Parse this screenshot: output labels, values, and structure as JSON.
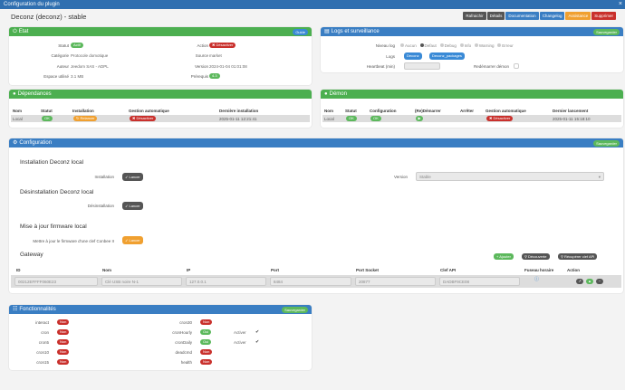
{
  "dialog": {
    "title": "Configuration du plugin",
    "close": "×"
  },
  "plugin": {
    "title": "Deconz (deconz) - stable"
  },
  "toolbar": [
    {
      "label": "Rafraichir",
      "color": "#555555"
    },
    {
      "label": "Détails",
      "color": "#555555"
    },
    {
      "label": "Documentation",
      "color": "#3a7ec3"
    },
    {
      "label": "Changelog",
      "color": "#3a7ec3"
    },
    {
      "label": "Assistance",
      "color": "#f0a030"
    },
    {
      "label": "Supprimer",
      "color": "#c9302c"
    }
  ],
  "etat": {
    "title": "Etat",
    "guide": "Guide",
    "statut_label": "Statut",
    "statut": "Actif",
    "categorie_label": "Catégorie",
    "categorie": "Protocole domotique",
    "auteur_label": "Auteur",
    "auteur": "Jeedom SAS - ADPL",
    "espace_label": "Espace utilisé",
    "espace": "3.1 MB",
    "action_label": "Action",
    "action": "Désactiver",
    "source_label": "Source",
    "source": "market",
    "version_label": "Version",
    "version": "2024-01-04 01:01:08",
    "prerequis_label": "Prérequis",
    "prerequis": "4.3"
  },
  "logs": {
    "title": "Logs et surveillance",
    "save": "Sauvegarder",
    "niveau_label": "Niveau log",
    "levels": [
      "Aucun",
      "Defaut",
      "Debug",
      "Info",
      "Warning",
      "Erreur"
    ],
    "logs_label": "Logs",
    "log_buttons": [
      "Deconz",
      "Deconz_packages"
    ],
    "heartbeat_label": "Heartbeat (min)",
    "redemarrer_label": "Redémarrer démon"
  },
  "deps": {
    "title": "Dépendances",
    "headers": [
      "Nom",
      "Statut",
      "Installation",
      "Gestion automatique",
      "Dernière installation"
    ],
    "row": {
      "nom": "Local",
      "statut": "OK",
      "installation": "Relancer",
      "gestion": "Désactiver",
      "derniere": "2025-01-11 12:21:41"
    }
  },
  "demon": {
    "title": "Démon",
    "headers": [
      "Nom",
      "Statut",
      "Configuration",
      "(Re)Démarrer",
      "Arrêter",
      "Gestion automatique",
      "Dernier lancement"
    ],
    "row": {
      "nom": "Local",
      "statut": "OK",
      "configuration": "OK",
      "gestion": "Désactiver",
      "dernier": "2025-01-11 15:18:10"
    }
  },
  "config": {
    "title": "Configuration",
    "save": "Sauvegarder",
    "install_title": "Installation Deconz local",
    "install_label": "Installation",
    "lancer": "Lancer",
    "version_label": "Version",
    "version_value": "Stable",
    "uninstall_title": "Désinstallation Deconz local",
    "uninstall_label": "Désinstallation",
    "firmware_title": "Mise à jour firmware local",
    "firmware_label": "Mettre à jour le firmware d'une clef Conbee II",
    "gateway_title": "Gateway",
    "gw_add": "Ajouter",
    "gw_discover": "Découverte",
    "gw_apikey": "Récupérer clef API",
    "gw_headers": [
      "ID",
      "Nom",
      "IP",
      "Port",
      "Port Socket",
      "Clef API",
      "Fuseau horaire",
      "Action"
    ],
    "gw_row": {
      "id": "00212EFFFF060E23",
      "nom": "Clé USB noire N-1",
      "ip": "127.0.0.1",
      "port": "8484",
      "socket": "20877",
      "apikey": "DADBF9CE08"
    }
  },
  "fonct": {
    "title": "Fonctionnalités",
    "save": "Sauvegarder",
    "left": [
      {
        "label": "interact",
        "value": "Non"
      },
      {
        "label": "cron",
        "value": "Non"
      },
      {
        "label": "cron5",
        "value": "Non"
      },
      {
        "label": "cron10",
        "value": "Non"
      },
      {
        "label": "cron15",
        "value": "Non"
      }
    ],
    "right": [
      {
        "label": "cron30",
        "value": "Non"
      },
      {
        "label": "cronHourly",
        "value": "Oui"
      },
      {
        "label": "cronDaily",
        "value": "Oui"
      },
      {
        "label": "deadcmd",
        "value": "Non"
      },
      {
        "label": "health",
        "value": "Non"
      }
    ],
    "actif_label": "Activer"
  }
}
